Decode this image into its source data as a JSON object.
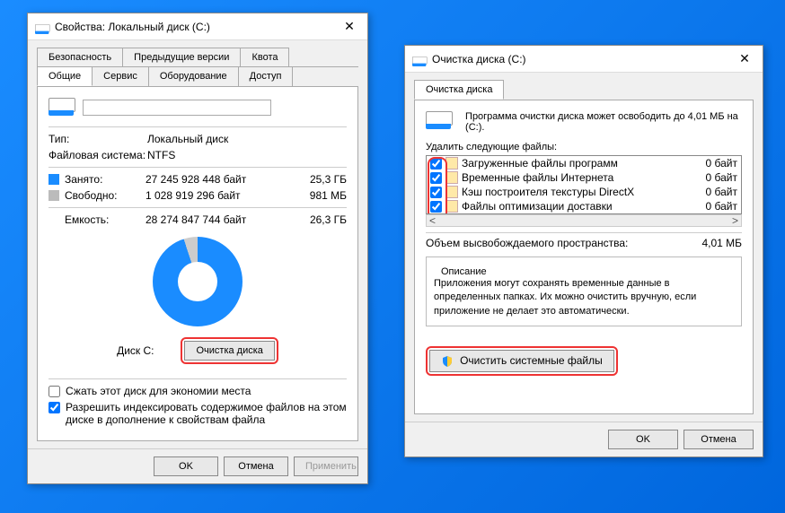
{
  "w1": {
    "title": "Свойства: Локальный диск (C:)",
    "tabs_row1": [
      "Безопасность",
      "Предыдущие версии",
      "Квота"
    ],
    "tabs_row2": [
      "Общие",
      "Сервис",
      "Оборудование",
      "Доступ"
    ],
    "active_tab": "Общие",
    "type_label": "Тип:",
    "type_value": "Локальный диск",
    "fs_label": "Файловая система:",
    "fs_value": "NTFS",
    "used_label": "Занято:",
    "used_bytes": "27 245 928 448 байт",
    "used_size": "25,3 ГБ",
    "free_label": "Свободно:",
    "free_bytes": "1 028 919 296 байт",
    "free_size": "981 МБ",
    "cap_label": "Емкость:",
    "cap_bytes": "28 274 847 744 байт",
    "cap_size": "26,3 ГБ",
    "disk_label": "Диск C:",
    "cleanup_btn": "Очистка диска",
    "compress_label": "Сжать этот диск для экономии места",
    "index_label": "Разрешить индексировать содержимое файлов на этом диске в дополнение к свойствам файла",
    "ok": "OK",
    "cancel": "Отмена",
    "apply": "Применить"
  },
  "w2": {
    "title": "Очистка диска  (C:)",
    "tab": "Очистка диска",
    "intro": "Программа очистки диска может освободить до 4,01 МБ на  (C:).",
    "delete_label": "Удалить следующие файлы:",
    "files": [
      {
        "checked": true,
        "name": "Загруженные файлы программ",
        "size": "0 байт"
      },
      {
        "checked": true,
        "name": "Временные файлы Интернета",
        "size": "0 байт"
      },
      {
        "checked": true,
        "name": "Кэш построителя текстуры DirectX",
        "size": "0 байт"
      },
      {
        "checked": true,
        "name": "Файлы оптимизации доставки",
        "size": "0 байт"
      }
    ],
    "space_label": "Объем высвобождаемого пространства:",
    "space_value": "4,01 МБ",
    "desc_title": "Описание",
    "desc_text": "Приложения могут сохранять временные данные в определенных папках. Их можно очистить вручную, если приложение не делает это автоматически.",
    "clean_sys_btn": "Очистить системные файлы",
    "ok": "OK",
    "cancel": "Отмена"
  }
}
